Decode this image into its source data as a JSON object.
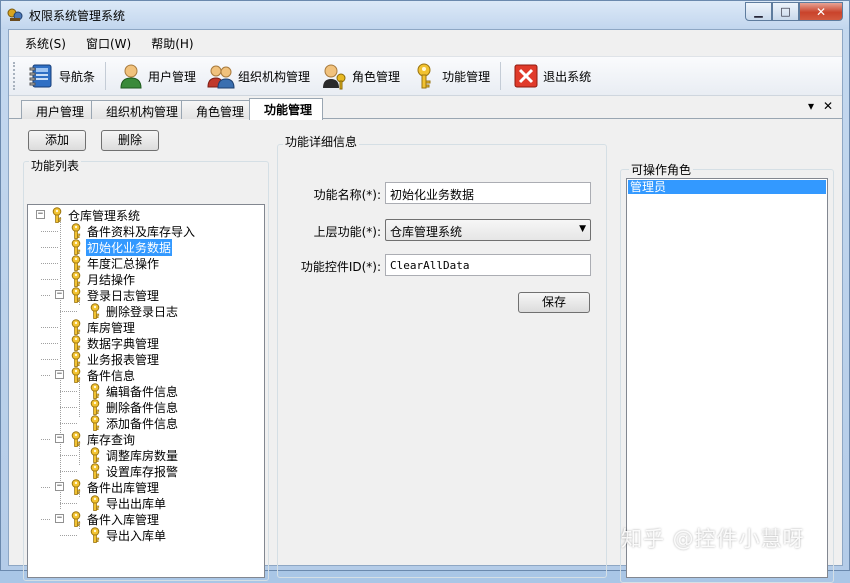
{
  "window": {
    "title": "权限系统管理系统"
  },
  "menu": {
    "items": [
      "系统(S)",
      "窗口(W)",
      "帮助(H)"
    ]
  },
  "toolbar": {
    "items": [
      {
        "label": "导航条",
        "icon": "notebook-icon"
      },
      {
        "label": "用户管理",
        "icon": "user-icon"
      },
      {
        "label": "组织机构管理",
        "icon": "users-group-icon"
      },
      {
        "label": "角色管理",
        "icon": "role-icon"
      },
      {
        "label": "功能管理",
        "icon": "key-icon"
      },
      {
        "label": "退出系统",
        "icon": "exit-icon"
      }
    ]
  },
  "tabs": {
    "items": [
      "用户管理",
      "组织机构管理",
      "角色管理",
      "功能管理"
    ],
    "active_index": 3
  },
  "left": {
    "add_label": "添加",
    "delete_label": "删除",
    "tree_title": "功能列表"
  },
  "tree": {
    "nodes": [
      "仓库管理系统",
      "备件资料及库存导入",
      "初始化业务数据",
      "年度汇总操作",
      "月结操作",
      "登录日志管理",
      "删除登录日志",
      "库房管理",
      "数据字典管理",
      "业务报表管理",
      "备件信息",
      "编辑备件信息",
      "删除备件信息",
      "添加备件信息",
      "库存查询",
      "调整库房数量",
      "设置库存报警",
      "备件出库管理",
      "导出出库单",
      "备件入库管理",
      "导出入库单"
    ],
    "selected": "初始化业务数据"
  },
  "detail": {
    "title": "功能详细信息",
    "name_label": "功能名称(*):",
    "name_value": "初始化业务数据",
    "parent_label": "上层功能(*):",
    "parent_value": "仓库管理系统",
    "control_label": "功能控件ID(*):",
    "control_value": "ClearAllData",
    "save_label": "保存"
  },
  "roles": {
    "title": "可操作角色",
    "items": [
      "管理员"
    ]
  },
  "watermark": "知乎 @控件小慧呀"
}
